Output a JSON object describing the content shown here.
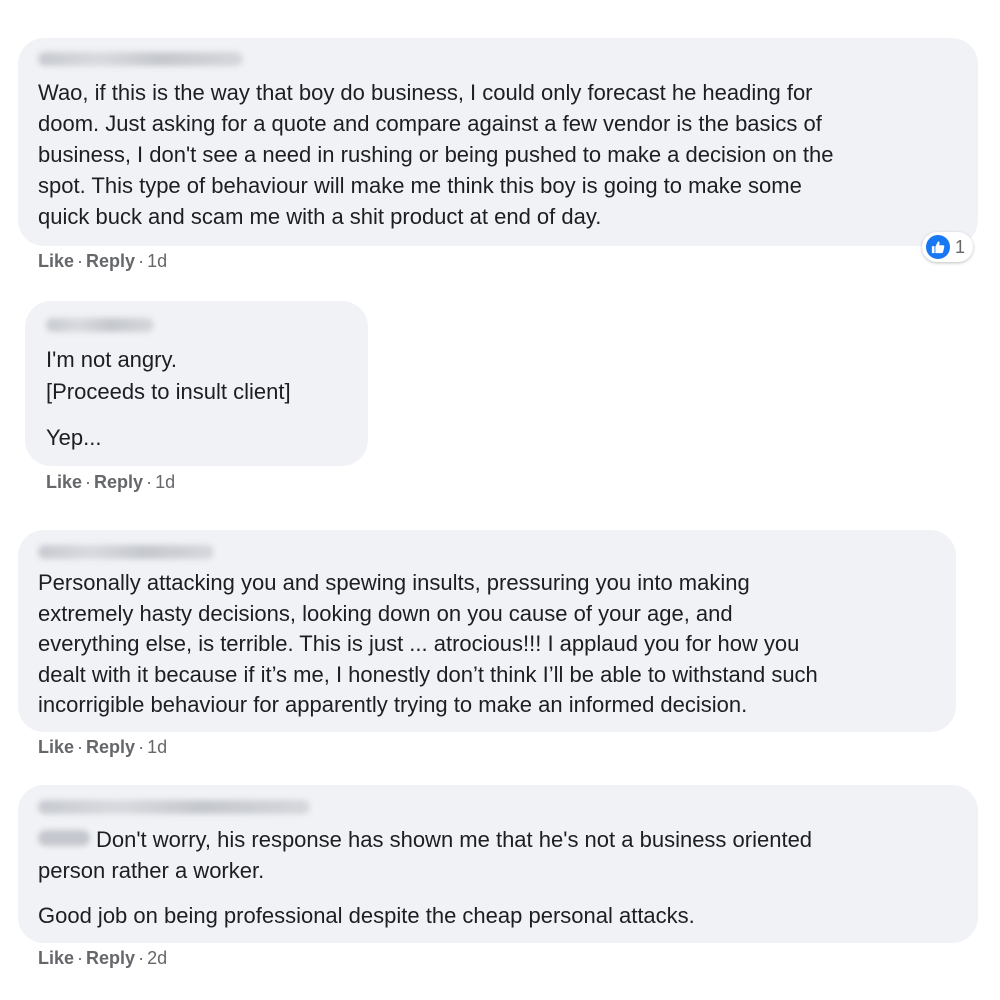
{
  "comments": [
    {
      "author": "",
      "lines": [
        "Wao, if this is the way that boy do business, I could only forecast he heading for",
        "doom. Just asking for a quote and compare against a few vendor is the basics of",
        "business, I don't see a need in rushing or being pushed to make a decision on the",
        "spot. This type of behaviour will make me think this boy is going to make some",
        "quick buck and scam me with a shit product at end of day."
      ],
      "like_label": "Like",
      "reply_label": "Reply",
      "time": "1d",
      "reaction": {
        "icon": "thumbs-up-icon",
        "count": "1",
        "color": "#1877f2"
      }
    },
    {
      "author": "",
      "lines": [
        "I'm not angry.",
        "[Proceeds to insult client]",
        "Yep..."
      ],
      "like_label": "Like",
      "reply_label": "Reply",
      "time": "1d"
    },
    {
      "author": "",
      "lines": [
        "Personally attacking you and spewing insults, pressuring you into making",
        "extremely hasty decisions, looking down on you cause of your age, and",
        "everything else, is terrible. This is just ... atrocious!!! I applaud you for how you",
        "dealt with it because if it’s me, I honestly don’t think I’ll be able to withstand such",
        "incorrigible behaviour for apparently trying to make an informed decision."
      ],
      "like_label": "Like",
      "reply_label": "Reply",
      "time": "1d"
    },
    {
      "author": "",
      "lines": [
        "Don't worry, his response has shown me that he's not a business oriented",
        "person rather a worker.",
        "Good job on being professional despite the cheap personal attacks."
      ],
      "like_label": "Like",
      "reply_label": "Reply",
      "time": "2d"
    }
  ],
  "separator": "·",
  "colors": {
    "bubble": "#f0f2f5",
    "text": "#1c1e21",
    "meta": "#65676b",
    "like_blue": "#1877f2"
  }
}
